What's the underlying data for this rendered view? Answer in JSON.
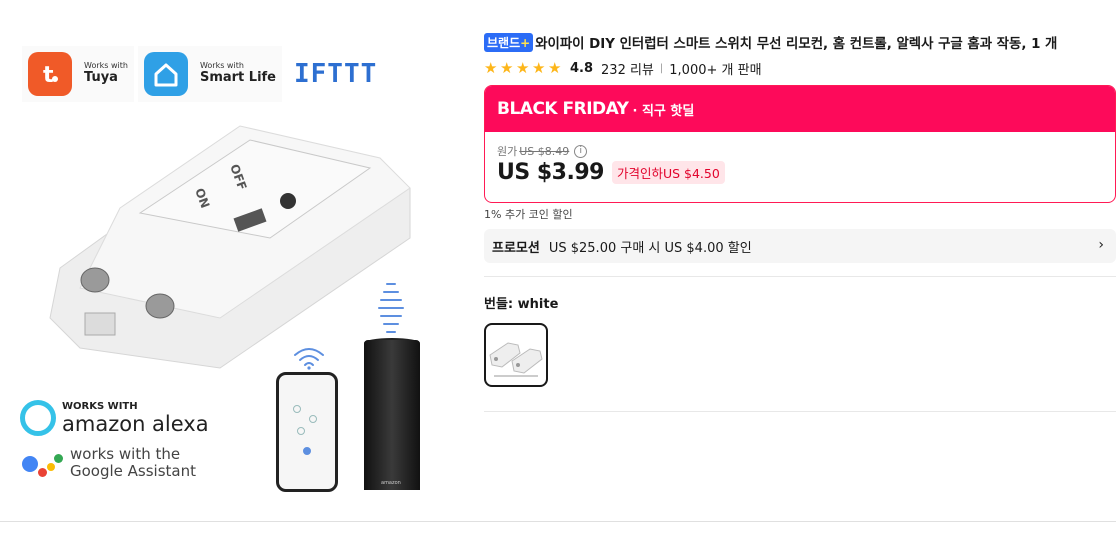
{
  "gallery": {
    "badges": {
      "tuya": {
        "small": "Works with",
        "big": "Tuya"
      },
      "smart_life": {
        "small": "Works with",
        "big": "Smart Life"
      },
      "ifttt": "IFTTT"
    },
    "device_labels": {
      "on": "ON",
      "off": "OFF"
    },
    "alexa": {
      "small": "WORKS WITH",
      "big": "amazon alexa"
    },
    "google": {
      "line1": "works with the",
      "line2": "Google Assistant"
    },
    "speaker_brand": "amazon"
  },
  "product": {
    "brand_badge": "브랜드",
    "brand_badge_plus": "+",
    "title": "와이파이 DIY 인터럽터 스마트 스위치 무선 리모컨, 홈 컨트롤, 알렉사 구글 홈과 작동, 1 개",
    "rating": "4.8",
    "stars": 5,
    "reviews": "232 리뷰",
    "sold": "1,000+ 개 판매",
    "promo_event": {
      "title": "BLACK FRIDAY",
      "subtitle": "· 직구 핫딜",
      "color": "#fd0a5a"
    },
    "original_label": "원가",
    "original_price": "US $8.49",
    "price": "US $3.99",
    "discount": "가격인하US $4.50",
    "coin": "1% 추가 코인 할인",
    "promotion": {
      "label": "프로모션",
      "text": "US $25.00 구매 시 US $4.00 할인"
    },
    "bundle_label": "번들: white"
  }
}
